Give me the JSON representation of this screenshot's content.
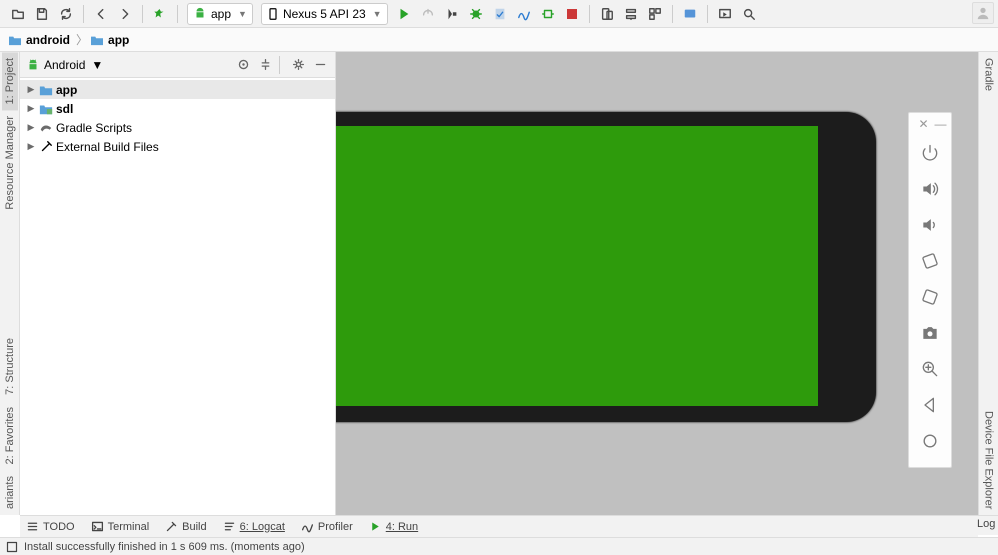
{
  "toolbar": {
    "run_config": "app",
    "device": "Nexus 5 API 23"
  },
  "breadcrumb": {
    "items": [
      "android",
      "app"
    ]
  },
  "left_tabs": {
    "project": "1: Project",
    "resmgr": "Resource Manager",
    "structure": "7: Structure",
    "favorites": "2: Favorites",
    "variants": "ariants"
  },
  "right_tabs": {
    "gradle": "Gradle",
    "device_explorer": "Device File Explorer"
  },
  "project_panel": {
    "title": "Android",
    "nodes": {
      "app": "app",
      "sdl": "sdl",
      "gradle": "Gradle Scripts",
      "external": "External Build Files"
    }
  },
  "bottom_tabs": {
    "todo": "TODO",
    "terminal": "Terminal",
    "build": "Build",
    "logcat": "6: Logcat",
    "profiler": "Profiler",
    "run": "4: Run"
  },
  "right_bottom": {
    "log": "Log"
  },
  "status": {
    "text": "Install successfully finished in 1 s 609 ms. (moments ago)"
  },
  "emulator": {
    "screen_color": "#2e9b0c"
  }
}
